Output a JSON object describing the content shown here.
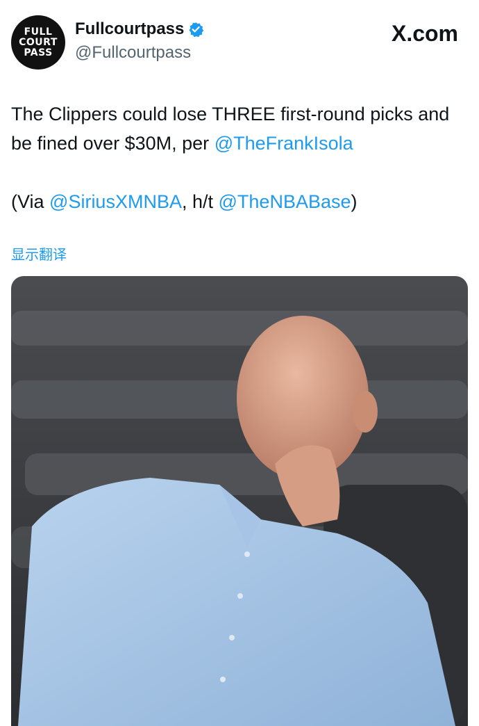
{
  "tweet": {
    "avatar_lines": [
      "FULL",
      "COURT",
      "PASS"
    ],
    "author_name": "Fullcourtpass",
    "author_handle": "@Fullcourtpass",
    "verified_icon": "verified-badge-icon",
    "site_label": "X.com",
    "text_line1_pre": "The Clippers could lose THREE first-round picks and be fined over $30M, per ",
    "mention_1": "@TheFrankIsola",
    "text_line2_pre": "(Via ",
    "mention_2": "@SiriusXMNBA",
    "text_line2_mid": ", h/t ",
    "mention_3": "@TheNBABase",
    "text_line2_post": ")",
    "translate_label": "显示翻译"
  },
  "colors": {
    "accent": "#1d9bf0",
    "text": "#0f1419",
    "muted": "#536471"
  }
}
